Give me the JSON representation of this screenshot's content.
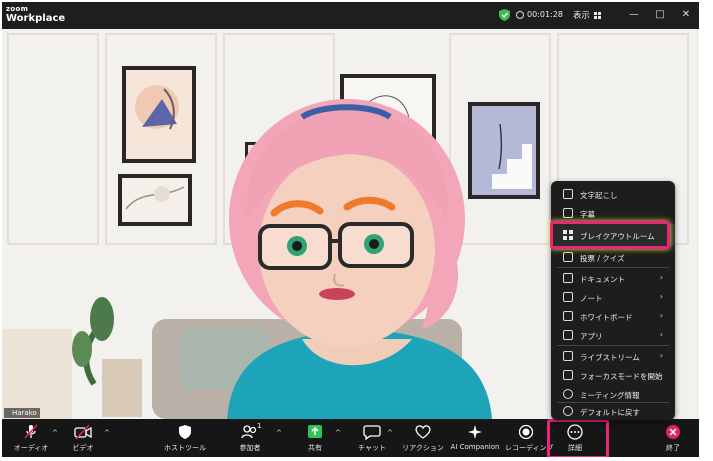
{
  "app": {
    "logo_top": "zoom",
    "logo_bottom": "Workplace"
  },
  "titlebar": {
    "timer": "00:01:28",
    "view_label": "表示",
    "colors": {
      "bg": "#1e1e1e",
      "shield": "#3fbf4a"
    }
  },
  "participant": {
    "name": "Harako"
  },
  "toolbar": {
    "audio": "オーディオ",
    "video": "ビデオ",
    "host_tools": "ホストツール",
    "participants": "参加者",
    "participants_count": "1",
    "share": "共有",
    "chat": "チャット",
    "reactions": "リアクション",
    "ai_companion": "AI Companion",
    "recording": "レコーディング",
    "more": "詳細",
    "end": "終了"
  },
  "more_menu": {
    "items": [
      {
        "label": "文字起こし",
        "icon": "transcript-icon",
        "submenu": false
      },
      {
        "label": "字幕",
        "icon": "captions-icon",
        "submenu": false
      },
      {
        "label": "ブレイクアウトルーム",
        "icon": "breakout-rooms-icon",
        "submenu": false,
        "highlighted": true
      },
      {
        "label": "投票 / クイズ",
        "icon": "poll-icon",
        "submenu": false
      },
      {
        "label": "ドキュメント",
        "icon": "document-icon",
        "submenu": true
      },
      {
        "label": "ノート",
        "icon": "notes-icon",
        "submenu": true
      },
      {
        "label": "ホワイトボード",
        "icon": "whiteboard-icon",
        "submenu": true
      },
      {
        "label": "アプリ",
        "icon": "apps-icon",
        "submenu": true
      },
      {
        "label": "ライブストリーム",
        "icon": "livestream-icon",
        "submenu": true
      },
      {
        "label": "フォーカスモードを開始",
        "icon": "focus-mode-icon",
        "submenu": false
      },
      {
        "label": "ミーティング情報",
        "icon": "info-icon",
        "submenu": false
      },
      {
        "label": "デフォルトに戻す",
        "icon": "reset-icon",
        "submenu": false
      }
    ]
  },
  "highlight_color": "#f0237a",
  "share_color": "#2fc15a",
  "end_color": "#e0245e"
}
